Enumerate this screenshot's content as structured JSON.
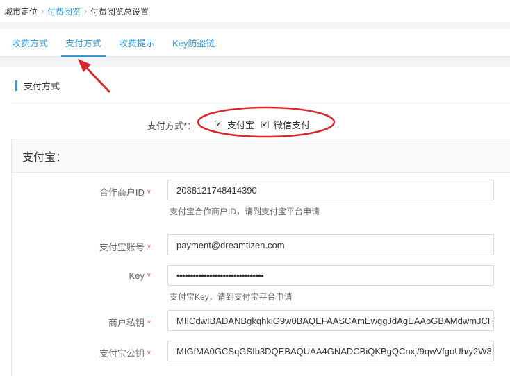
{
  "breadcrumb": {
    "items": [
      "城市定位",
      "付费阅览",
      "付费阅览总设置"
    ],
    "separator": "›"
  },
  "tabs": [
    {
      "label": "收费方式",
      "active": false
    },
    {
      "label": "支付方式",
      "active": true
    },
    {
      "label": "收费提示",
      "active": false
    },
    {
      "label": "Key防盗链",
      "active": false
    }
  ],
  "section": {
    "title": "支付方式"
  },
  "payment_methods": {
    "label": "支付方式*：",
    "options": [
      {
        "label": "支付宝",
        "checked": true
      },
      {
        "label": "微信支付",
        "checked": true
      }
    ]
  },
  "alipay": {
    "title": "支付宝：",
    "fields": {
      "partner_id": {
        "label": "合作商户ID",
        "value": "2088121748414390",
        "help": "支付宝合作商户ID，请到支付宝平台申请"
      },
      "account": {
        "label": "支付宝账号",
        "value": "payment@dreamtizen.com"
      },
      "key": {
        "label": "Key",
        "value": "••••••••••••••••••••••••••••••••",
        "help": "支付宝Key，请到支付宝平台申请"
      },
      "private_key": {
        "label": "商户私钥",
        "value": "MIICdwIBADANBgkqhkiG9w0BAQEFAASCAmEwggJdAgEAAoGBAMdwmJCH"
      },
      "public_key": {
        "label": "支付宝公钥",
        "value": "MIGfMA0GCSqGSIb3DQEBAQUAA4GNADCBiQKBgQCnxj/9qwVfgoUh/y2W8"
      }
    },
    "required_mark": "*"
  },
  "colors": {
    "accent": "#3399dd",
    "annotation": "#d9272e"
  }
}
